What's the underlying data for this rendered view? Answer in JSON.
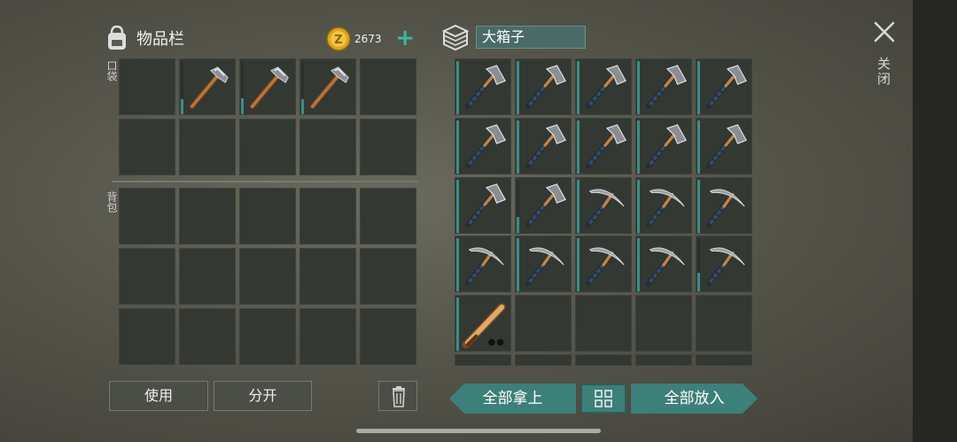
{
  "inventory": {
    "title": "物品栏",
    "pocket_label": "口袋",
    "backpack_label": "背包"
  },
  "currency": {
    "amount": "2673",
    "plus": "+",
    "coin_letter": "Z"
  },
  "container": {
    "title": "大箱子"
  },
  "close": {
    "label": "关闭"
  },
  "buttons": {
    "use": "使用",
    "split": "分开",
    "take_all": "全部拿上",
    "put_all": "全部放入"
  },
  "colors": {
    "accent_teal": "#3d7f79",
    "plus_green": "#3fb6a0",
    "cell_bg": "#333833",
    "durability": "#3c8c86"
  },
  "pocket_items": [
    {
      "type": "hammer",
      "durability": 0.28
    },
    {
      "type": "hammer",
      "durability": 0.3
    },
    {
      "type": "hammer",
      "durability": 0.28
    }
  ],
  "box_items": [
    {
      "type": "axe",
      "durability": 1.0
    },
    {
      "type": "axe",
      "durability": 1.0
    },
    {
      "type": "axe",
      "durability": 1.0
    },
    {
      "type": "axe",
      "durability": 1.0
    },
    {
      "type": "axe",
      "durability": 1.0
    },
    {
      "type": "axe",
      "durability": 1.0
    },
    {
      "type": "axe",
      "durability": 1.0
    },
    {
      "type": "axe",
      "durability": 1.0
    },
    {
      "type": "axe",
      "durability": 1.0
    },
    {
      "type": "axe",
      "durability": 1.0
    },
    {
      "type": "axe",
      "durability": 1.0
    },
    {
      "type": "axe",
      "durability": 0.3
    },
    {
      "type": "pickaxe",
      "durability": 1.0
    },
    {
      "type": "pickaxe",
      "durability": 1.0
    },
    {
      "type": "pickaxe",
      "durability": 1.0
    },
    {
      "type": "pickaxe",
      "durability": 1.0
    },
    {
      "type": "pickaxe",
      "durability": 1.0
    },
    {
      "type": "pickaxe",
      "durability": 1.0
    },
    {
      "type": "pickaxe",
      "durability": 1.0
    },
    {
      "type": "pickaxe",
      "durability": 0.35
    },
    {
      "type": "bat",
      "durability": 1.0
    }
  ]
}
